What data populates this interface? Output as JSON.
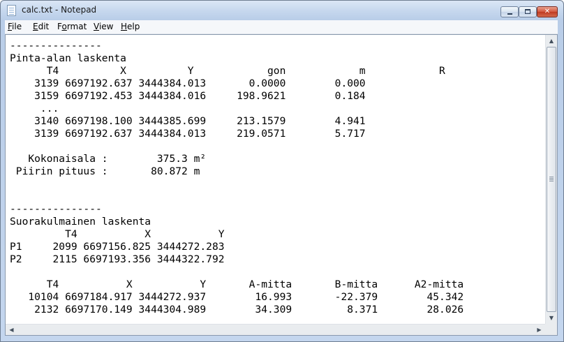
{
  "window": {
    "title": "calc.txt - Notepad",
    "app_icon": "notepad-icon"
  },
  "caption_buttons": {
    "minimize_icon": "minimize-icon",
    "maximize_icon": "maximize-icon",
    "close_icon": "close-icon",
    "close_glyph": "✕"
  },
  "menu": {
    "items": [
      {
        "accel": "F",
        "rest": "ile"
      },
      {
        "accel": "E",
        "rest": "dit"
      },
      {
        "accel": "o",
        "pre": "F",
        "rest": "rmat"
      },
      {
        "accel": "V",
        "rest": "iew"
      },
      {
        "accel": "H",
        "rest": "elp"
      }
    ]
  },
  "document": {
    "lines": [
      "---------------",
      "Pinta-alan laskenta",
      "      T4          X          Y            gon            m            R",
      "    3139 6697192.637 3444384.013       0.0000        0.000",
      "    3159 6697192.453 3444384.016     198.9621        0.184",
      "     ...",
      "    3140 6697198.100 3444385.699     213.1579        4.941",
      "    3139 6697192.637 3444384.013     219.0571        5.717",
      "",
      "   Kokonaisala :        375.3 m²",
      " Piirin pituus :       80.872 m",
      "",
      "",
      "---------------",
      "Suorakulmainen laskenta",
      "         T4           X           Y",
      "P1     2099 6697156.825 3444272.283",
      "P2     2115 6697193.356 3444322.792",
      "",
      "      T4           X           Y       A-mitta       B-mitta      A2-mitta",
      "   10104 6697184.917 3444272.937        16.993       -22.379        45.342",
      "    2132 6697170.149 3444304.989        34.309         8.371        28.026"
    ]
  },
  "scrollbars": {
    "up_arrow": "▲",
    "down_arrow": "▼",
    "left_arrow": "◀",
    "right_arrow": "▶"
  },
  "colors": {
    "title_gradient_top": "#dbe7f6",
    "close_button": "#c7432a",
    "editor_background": "#ffffff"
  }
}
